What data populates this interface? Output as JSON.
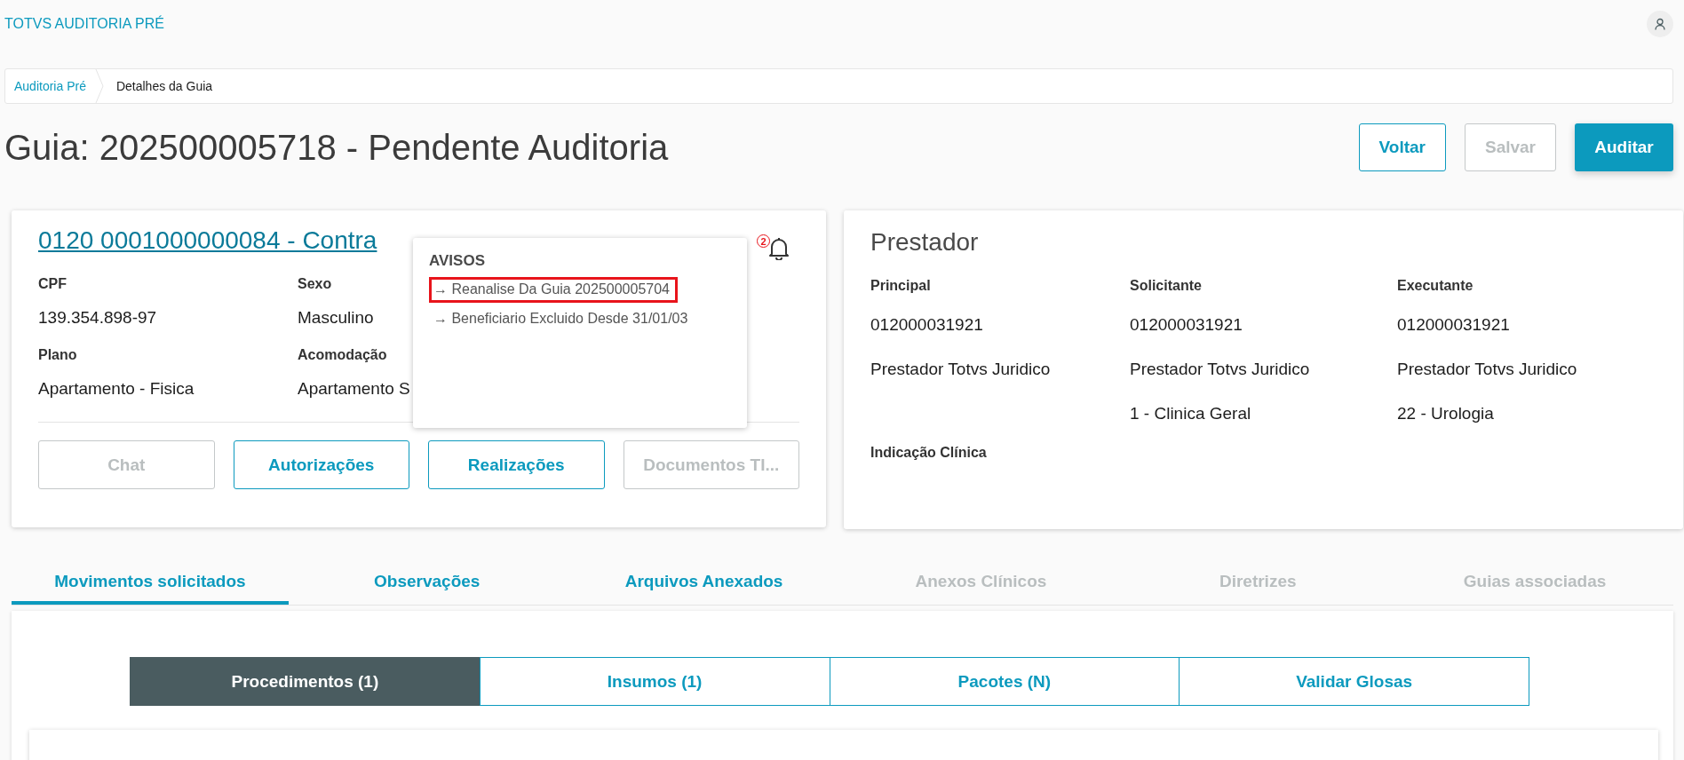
{
  "app": {
    "title": "TOTVS AUDITORIA PRÉ"
  },
  "breadcrumb": [
    {
      "label": "Auditoria Pré",
      "kind": "link"
    },
    {
      "label": "Detalhes da Guia",
      "kind": "current"
    }
  ],
  "page_title": "Guia: 202500005718 - Pendente Auditoria",
  "actions": [
    {
      "label": "Voltar",
      "kind": "secondary",
      "disabled": false
    },
    {
      "label": "Salvar",
      "kind": "secondary",
      "disabled": true
    },
    {
      "label": "Auditar",
      "kind": "primary",
      "disabled": false
    }
  ],
  "beneficiary": {
    "link": "0120 0001000000084 - Contra",
    "fields": [
      {
        "label": "CPF",
        "value": "139.354.898-97"
      },
      {
        "label": "Sexo",
        "value": "Masculino"
      },
      {
        "label": "Plano",
        "value": "Apartamento - Fisica"
      },
      {
        "label": "Acomodação",
        "value": "Apartamento S"
      }
    ],
    "buttons": [
      {
        "label": "Chat",
        "disabled": true
      },
      {
        "label": "Autorizações",
        "disabled": false
      },
      {
        "label": "Realizações",
        "disabled": false
      },
      {
        "label": "Documentos TI...",
        "disabled": true
      }
    ]
  },
  "alerts": {
    "count": "2",
    "title": "AVISOS",
    "items": [
      {
        "text": "→ Reanalise Da Guia 202500005704",
        "highlighted": true
      },
      {
        "text": "→ Beneficiario Excluido Desde 31/01/03",
        "highlighted": false
      }
    ]
  },
  "prestador": {
    "title": "Prestador",
    "columns": [
      {
        "label": "Principal",
        "values": [
          "012000031921",
          "Prestador Totvs Juridico"
        ]
      },
      {
        "label": "Solicitante",
        "values": [
          "012000031921",
          "Prestador Totvs Juridico",
          "1 - Clinica Geral"
        ]
      },
      {
        "label": "Executante",
        "values": [
          "012000031921",
          "Prestador Totvs Juridico",
          "22 - Urologia"
        ]
      }
    ],
    "note_label": "Indicação Clínica"
  },
  "tabs": [
    {
      "label": "Movimentos solicitados",
      "selected": true,
      "disabled": false
    },
    {
      "label": "Observações",
      "selected": false,
      "disabled": false
    },
    {
      "label": "Arquivos Anexados",
      "selected": false,
      "disabled": false
    },
    {
      "label": "Anexos Clínicos",
      "selected": false,
      "disabled": true
    },
    {
      "label": "Diretrizes",
      "selected": false,
      "disabled": true
    },
    {
      "label": "Guias associadas",
      "selected": false,
      "disabled": true
    }
  ],
  "subtabs": [
    {
      "label": "Procedimentos (1)",
      "selected": true
    },
    {
      "label": "Insumos (1)",
      "selected": false
    },
    {
      "label": "Pacotes (N)",
      "selected": false
    },
    {
      "label": "Validar Glosas",
      "selected": false
    }
  ]
}
